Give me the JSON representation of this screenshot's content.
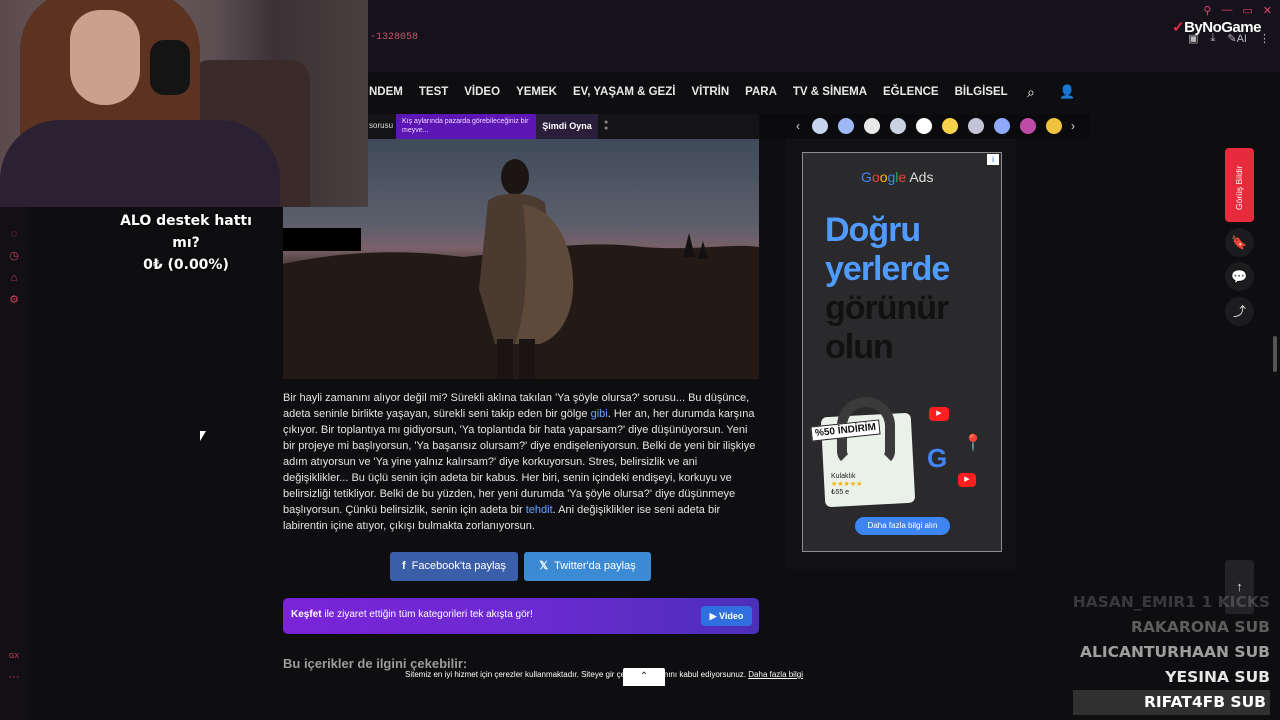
{
  "browser": {
    "url_fragment": "-1328058",
    "window_controls": [
      "⚲",
      "—",
      "▭",
      "✕"
    ],
    "tool_icons": [
      "▣",
      "⤓",
      "✎AI",
      "⋮"
    ],
    "logo": {
      "mark": "✓",
      "name": "ByNoGame"
    }
  },
  "gx_sidebar": {
    "icons": [
      "◌",
      "◷",
      "⌂",
      "⚙"
    ],
    "bottom_label": "GX",
    "more": "···"
  },
  "nav": {
    "items": [
      "NDEM",
      "TEST",
      "VİDEO",
      "YEMEK",
      "EV, YAŞAM & GEZİ",
      "VİTRİN",
      "PARA",
      "TV & SİNEMA",
      "EĞLENCE",
      "BİLGİSEL"
    ],
    "search_icon": "⌕",
    "user_icon": "👤"
  },
  "promo": {
    "left_text": "sorusu",
    "banner_text": "Kış aylarında pazarda görebileceğiniz bir meyve...",
    "button_label": "Şimdi Oyna"
  },
  "stories": {
    "prev": "‹",
    "next": "›",
    "colors": [
      "#c7d4ee",
      "#9fb8f5",
      "#e8e8e8",
      "#c8d2e0",
      "#ffffff",
      "#f5d24a",
      "#c4c4d6",
      "#8ea9ff",
      "#c04aa8",
      "#f0c240"
    ]
  },
  "article": {
    "p1": "Bir hayli zamanını alıyor değil mi? Sürekli aklına takılan 'Ya şöyle olursa?' sorusu... Bu düşünce, adeta seninle birlikte yaşayan, sürekli seni takip eden bir gölge ",
    "link1": "gibi",
    "p2": ". Her an, her durumda karşına çıkıyor. Bir toplantıya mı gidiyorsun, 'Ya toplantıda bir hata yaparsam?' diye düşünüyorsun. Yeni bir projeye mi başlıyorsun, 'Ya başarısız olursam?' diye endişeleniyorsun. Belki de yeni bir ilişkiye adım atıyorsun ve 'Ya yine yalnız kalırsam?' diye korkuyorsun. Stres, belirsizlik ve ani değişiklikler... Bu üçlü senin için adeta bir kabus. Her biri, senin içindeki endişeyi, korkuyu ve belirsizliği tetikliyor. Belki de bu yüzden, her yeni durumda 'Ya şöyle olursa?' diye düşünmeye başlıyorsun. Çünkü belirsizlik, senin için adeta bir ",
    "link2": "tehdit",
    "p3": ". Ani değişiklikler ise seni adeta bir labirentin içine atıyor, çıkışı bulmakta zorlanıyorsun."
  },
  "share": {
    "facebook_icon": "f",
    "facebook_label": "Facebook'ta paylaş",
    "twitter_icon": "𝕏",
    "twitter_label": "Twitter'da paylaş"
  },
  "explore": {
    "bold": "Keşfet",
    "text": " ile ziyaret ettiğin tüm kategorileri tek akışta gör!",
    "button_label": "Video"
  },
  "related_heading": "Bu içerikler de ilgini çekebilir:",
  "cookie": {
    "text": "Sitemiz en iyi hizmet için çerezler kullanmaktadır. Siteye gir          çerez kullanımını kabul ediyorsunuz.",
    "link": "Daha fazla bilgi",
    "chevron": "⌃"
  },
  "ad": {
    "info_icon": "i",
    "brand_google": [
      "G",
      "o",
      "o",
      "g",
      "l",
      "e"
    ],
    "brand_ads": " Ads",
    "headline_blue": [
      "Doğru",
      "yerlerde"
    ],
    "headline_dark": [
      "görünür",
      "olun"
    ],
    "discount": "%50 İNDİRİM",
    "product_name": "Kulaklık",
    "product_stars": "★★★★★",
    "product_price": "₺55 e",
    "youtube_icon": "▶",
    "g_icon": "G",
    "maps_icon": "📍",
    "cta": "Daha fazla bilgi alın"
  },
  "floating": {
    "feedback_label": "Görüş Bildir",
    "icons": [
      "🔖",
      "💬",
      "⤴"
    ],
    "scroll_top": "↑"
  },
  "stream": {
    "title": "ALO destek hattı mı?",
    "amount": "0₺ (0.00%)",
    "subs": [
      {
        "name": "HASAN_EMIR1",
        "tag": "1 KICKS"
      },
      {
        "name": "RAKARONA",
        "tag": "SUB"
      },
      {
        "name": "ALICANTURHAAN",
        "tag": "SUB"
      },
      {
        "name": "YESINA",
        "tag": "SUB"
      },
      {
        "name": "RIFAT4FB",
        "tag": "SUB"
      }
    ]
  }
}
